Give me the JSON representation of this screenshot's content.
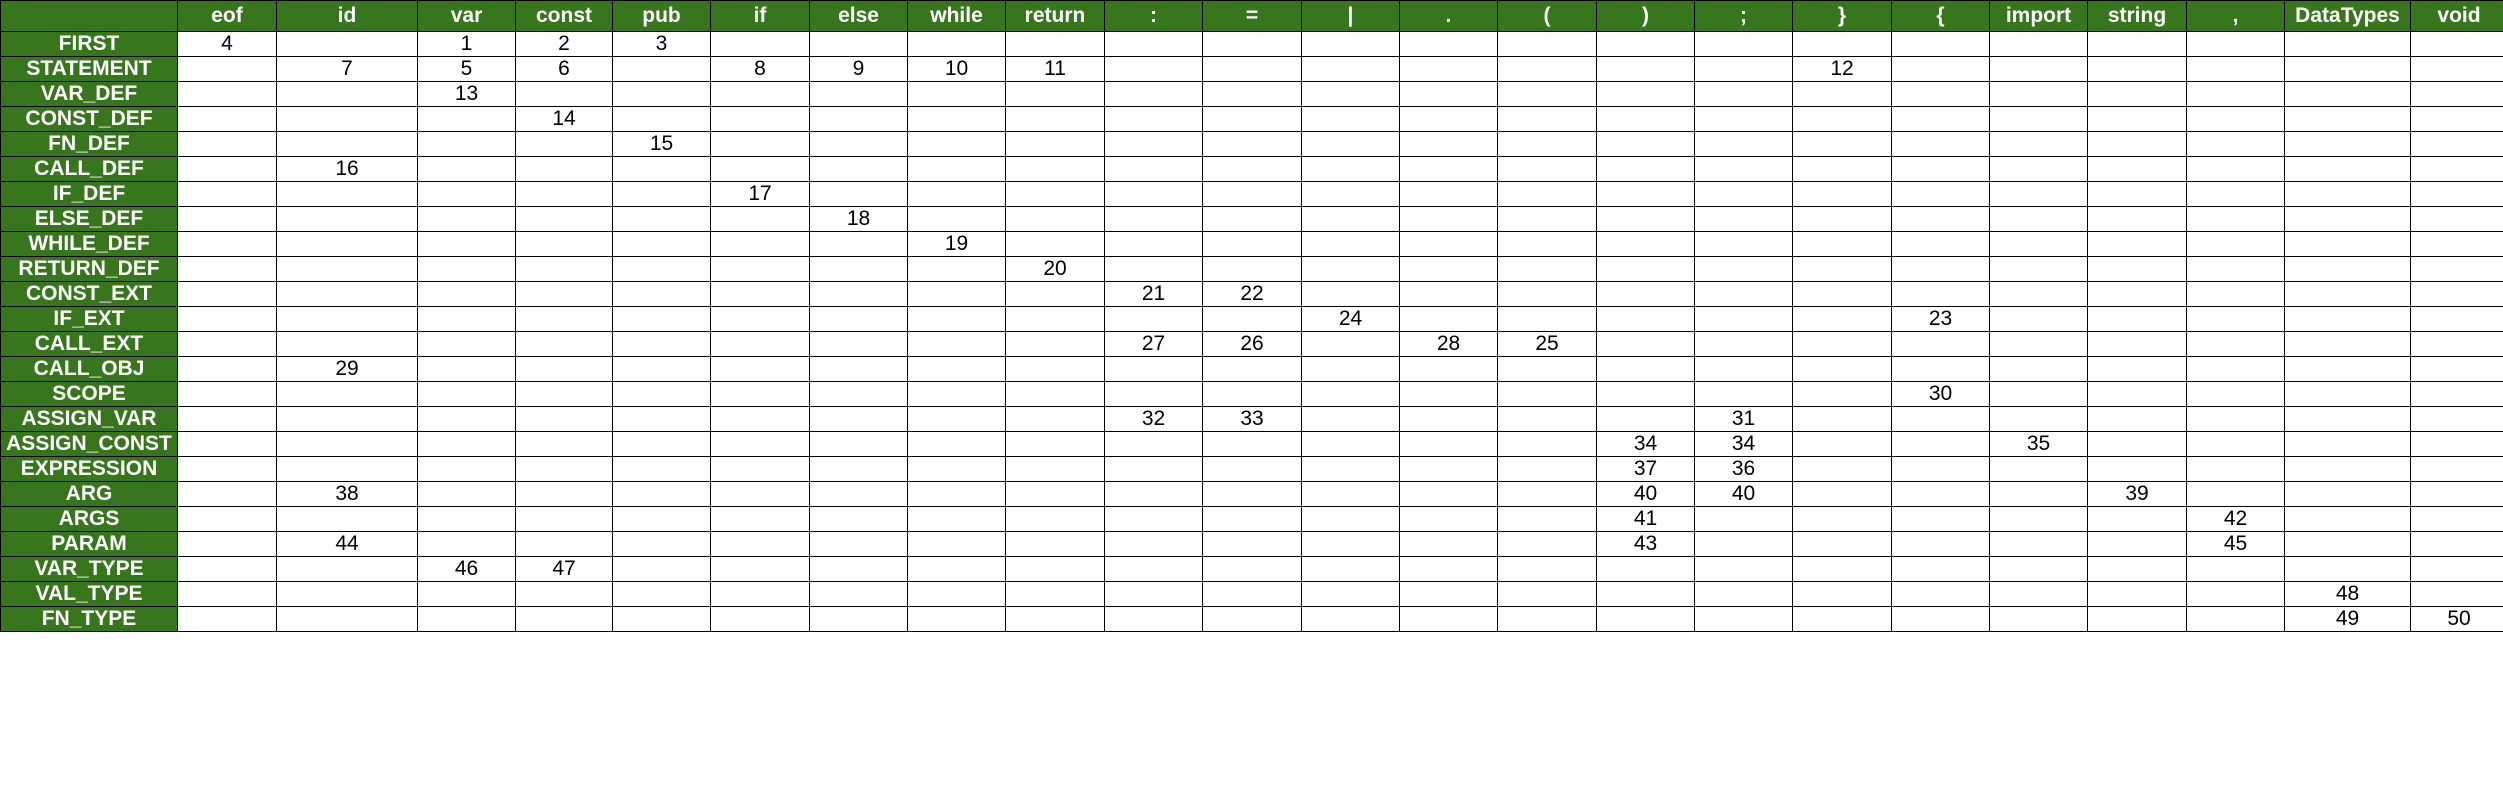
{
  "table": {
    "corner": "",
    "header_bg": "#38761d",
    "header_text_color": "#ffffff",
    "columns": [
      "eof",
      "id",
      "var",
      "const",
      "pub",
      "if",
      "else",
      "while",
      "return",
      ":",
      "=",
      "|",
      ".",
      "(",
      ")",
      ";",
      "}",
      "{",
      "import",
      "string",
      ",",
      "DataTypes",
      "void"
    ],
    "rows": [
      {
        "label": "FIRST",
        "cells": [
          "4",
          "",
          "1",
          "2",
          "3",
          "",
          "",
          "",
          "",
          "",
          "",
          "",
          "",
          "",
          "",
          "",
          "",
          "",
          "",
          "",
          "",
          "",
          ""
        ]
      },
      {
        "label": "STATEMENT",
        "cells": [
          "",
          "7",
          "5",
          "6",
          "",
          "8",
          "9",
          "10",
          "11",
          "",
          "",
          "",
          "",
          "",
          "",
          "",
          "12",
          "",
          "",
          "",
          "",
          "",
          ""
        ]
      },
      {
        "label": "VAR_DEF",
        "cells": [
          "",
          "",
          "13",
          "",
          "",
          "",
          "",
          "",
          "",
          "",
          "",
          "",
          "",
          "",
          "",
          "",
          "",
          "",
          "",
          "",
          "",
          "",
          ""
        ]
      },
      {
        "label": "CONST_DEF",
        "cells": [
          "",
          "",
          "",
          "14",
          "",
          "",
          "",
          "",
          "",
          "",
          "",
          "",
          "",
          "",
          "",
          "",
          "",
          "",
          "",
          "",
          "",
          "",
          ""
        ]
      },
      {
        "label": "FN_DEF",
        "cells": [
          "",
          "",
          "",
          "",
          "15",
          "",
          "",
          "",
          "",
          "",
          "",
          "",
          "",
          "",
          "",
          "",
          "",
          "",
          "",
          "",
          "",
          "",
          ""
        ]
      },
      {
        "label": "CALL_DEF",
        "cells": [
          "",
          "16",
          "",
          "",
          "",
          "",
          "",
          "",
          "",
          "",
          "",
          "",
          "",
          "",
          "",
          "",
          "",
          "",
          "",
          "",
          "",
          "",
          ""
        ]
      },
      {
        "label": "IF_DEF",
        "cells": [
          "",
          "",
          "",
          "",
          "",
          "17",
          "",
          "",
          "",
          "",
          "",
          "",
          "",
          "",
          "",
          "",
          "",
          "",
          "",
          "",
          "",
          "",
          ""
        ]
      },
      {
        "label": "ELSE_DEF",
        "cells": [
          "",
          "",
          "",
          "",
          "",
          "",
          "18",
          "",
          "",
          "",
          "",
          "",
          "",
          "",
          "",
          "",
          "",
          "",
          "",
          "",
          "",
          "",
          ""
        ]
      },
      {
        "label": "WHILE_DEF",
        "cells": [
          "",
          "",
          "",
          "",
          "",
          "",
          "",
          "19",
          "",
          "",
          "",
          "",
          "",
          "",
          "",
          "",
          "",
          "",
          "",
          "",
          "",
          "",
          ""
        ]
      },
      {
        "label": "RETURN_DEF",
        "cells": [
          "",
          "",
          "",
          "",
          "",
          "",
          "",
          "",
          "20",
          "",
          "",
          "",
          "",
          "",
          "",
          "",
          "",
          "",
          "",
          "",
          "",
          "",
          ""
        ]
      },
      {
        "label": "CONST_EXT",
        "cells": [
          "",
          "",
          "",
          "",
          "",
          "",
          "",
          "",
          "",
          "21",
          "22",
          "",
          "",
          "",
          "",
          "",
          "",
          "",
          "",
          "",
          "",
          "",
          ""
        ]
      },
      {
        "label": "IF_EXT",
        "cells": [
          "",
          "",
          "",
          "",
          "",
          "",
          "",
          "",
          "",
          "",
          "",
          "24",
          "",
          "",
          "",
          "",
          "",
          "23",
          "",
          "",
          "",
          "",
          ""
        ]
      },
      {
        "label": "CALL_EXT",
        "cells": [
          "",
          "",
          "",
          "",
          "",
          "",
          "",
          "",
          "",
          "27",
          "26",
          "",
          "28",
          "25",
          "",
          "",
          "",
          "",
          "",
          "",
          "",
          "",
          ""
        ]
      },
      {
        "label": "CALL_OBJ",
        "cells": [
          "",
          "29",
          "",
          "",
          "",
          "",
          "",
          "",
          "",
          "",
          "",
          "",
          "",
          "",
          "",
          "",
          "",
          "",
          "",
          "",
          "",
          "",
          ""
        ]
      },
      {
        "label": "SCOPE",
        "cells": [
          "",
          "",
          "",
          "",
          "",
          "",
          "",
          "",
          "",
          "",
          "",
          "",
          "",
          "",
          "",
          "",
          "",
          "30",
          "",
          "",
          "",
          "",
          ""
        ]
      },
      {
        "label": "ASSIGN_VAR",
        "cells": [
          "",
          "",
          "",
          "",
          "",
          "",
          "",
          "",
          "",
          "32",
          "33",
          "",
          "",
          "",
          "",
          "31",
          "",
          "",
          "",
          "",
          "",
          "",
          ""
        ]
      },
      {
        "label": "ASSIGN_CONST",
        "cells": [
          "",
          "",
          "",
          "",
          "",
          "",
          "",
          "",
          "",
          "",
          "",
          "",
          "",
          "",
          "34",
          "34",
          "",
          "",
          "35",
          "",
          "",
          "",
          ""
        ]
      },
      {
        "label": "EXPRESSION",
        "cells": [
          "",
          "",
          "",
          "",
          "",
          "",
          "",
          "",
          "",
          "",
          "",
          "",
          "",
          "",
          "37",
          "36",
          "",
          "",
          "",
          "",
          "",
          "",
          ""
        ]
      },
      {
        "label": "ARG",
        "cells": [
          "",
          "38",
          "",
          "",
          "",
          "",
          "",
          "",
          "",
          "",
          "",
          "",
          "",
          "",
          "40",
          "40",
          "",
          "",
          "",
          "39",
          "",
          "",
          ""
        ]
      },
      {
        "label": "ARGS",
        "cells": [
          "",
          "",
          "",
          "",
          "",
          "",
          "",
          "",
          "",
          "",
          "",
          "",
          "",
          "",
          "41",
          "",
          "",
          "",
          "",
          "",
          "42",
          "",
          ""
        ]
      },
      {
        "label": "PARAM",
        "cells": [
          "",
          "44",
          "",
          "",
          "",
          "",
          "",
          "",
          "",
          "",
          "",
          "",
          "",
          "",
          "43",
          "",
          "",
          "",
          "",
          "",
          "45",
          "",
          ""
        ]
      },
      {
        "label": "VAR_TYPE",
        "cells": [
          "",
          "",
          "46",
          "47",
          "",
          "",
          "",
          "",
          "",
          "",
          "",
          "",
          "",
          "",
          "",
          "",
          "",
          "",
          "",
          "",
          "",
          "",
          ""
        ]
      },
      {
        "label": "VAL_TYPE",
        "cells": [
          "",
          "",
          "",
          "",
          "",
          "",
          "",
          "",
          "",
          "",
          "",
          "",
          "",
          "",
          "",
          "",
          "",
          "",
          "",
          "",
          "",
          "48",
          ""
        ]
      },
      {
        "label": "FN_TYPE",
        "cells": [
          "",
          "",
          "",
          "",
          "",
          "",
          "",
          "",
          "",
          "",
          "",
          "",
          "",
          "",
          "",
          "",
          "",
          "",
          "",
          "",
          "",
          "49",
          "50"
        ]
      }
    ]
  }
}
